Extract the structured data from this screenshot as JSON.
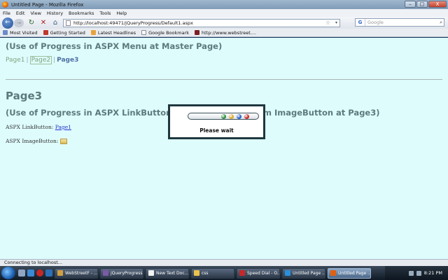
{
  "window": {
    "title": "Untitled Page - Mozilla Firefox",
    "min": "–",
    "max": "□",
    "close": "X"
  },
  "menubar": [
    "File",
    "Edit",
    "View",
    "History",
    "Bookmarks",
    "Tools",
    "Help"
  ],
  "nav": {
    "url": "http://localhost:49471/jQueryProgress/Default1.aspx",
    "search_placeholder": "Google"
  },
  "bookmarks": [
    {
      "label": "Most Visited",
      "color": "#6b8cc7"
    },
    {
      "label": "Getting Started",
      "color": "#c0392b"
    },
    {
      "label": "Latest Headlines",
      "color": "#e8a33c"
    },
    {
      "label": "Google Bookmark",
      "color": "#ffffff"
    },
    {
      "label": "http://www.webstreet....",
      "color": "#7b1f1f"
    }
  ],
  "content": {
    "master_heading": "(Use of Progress in ASPX Menu at Master Page)",
    "menu": {
      "page1": "Page1",
      "sep": "|",
      "page2": "Page2",
      "page3": "Page3"
    },
    "page_title": "Page3",
    "sub_heading": "(Use of Progress in ASPX LinkButton (Cross Postback from ImageButton at Page3)",
    "linkbutton_label": "ASPX LinkButton:",
    "linkbutton_link": "Page1",
    "imagebutton_label": "ASPX ImageButton:"
  },
  "modal": {
    "wait_text": "Please wait",
    "dots": [
      {
        "color": "#2e8b3a"
      },
      {
        "color": "#e0a62a"
      },
      {
        "color": "#2a5fc7"
      },
      {
        "color": "#c62828"
      }
    ]
  },
  "status": {
    "text": "Connecting to localhost..."
  },
  "taskbar": {
    "tasks": [
      {
        "label": "WebStreetF - ...",
        "color": "#d0a040",
        "active": false
      },
      {
        "label": "jQueryProgress...",
        "color": "#7b5aa6",
        "active": false
      },
      {
        "label": "New Text Doc...",
        "color": "#f2f2f2",
        "active": false
      },
      {
        "label": "css",
        "color": "#e8c24a",
        "active": false
      },
      {
        "label": "Speed Dial - O...",
        "color": "#c62828",
        "active": false
      },
      {
        "label": "Untitled Page ...",
        "color": "#2a8fdc",
        "active": false
      },
      {
        "label": "Untitled Page ...",
        "color": "#e06010",
        "active": true
      }
    ],
    "clock": "8:21 PM"
  }
}
